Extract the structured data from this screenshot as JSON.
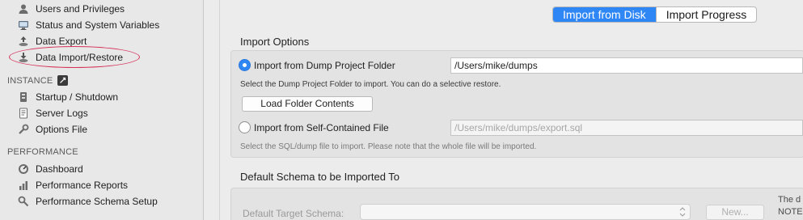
{
  "sidebar": {
    "management_items": [
      {
        "label": "Users and Privileges",
        "icon": "users-icon"
      },
      {
        "label": "Status and System Variables",
        "icon": "monitor-icon"
      },
      {
        "label": "Data Export",
        "icon": "export-icon"
      },
      {
        "label": "Data Import/Restore",
        "icon": "import-icon"
      }
    ],
    "instance_header": "INSTANCE",
    "instance_items": [
      {
        "label": "Startup / Shutdown",
        "icon": "power-icon"
      },
      {
        "label": "Server Logs",
        "icon": "log-icon"
      },
      {
        "label": "Options File",
        "icon": "wrench-icon"
      }
    ],
    "performance_header": "PERFORMANCE",
    "performance_items": [
      {
        "label": "Dashboard",
        "icon": "dashboard-icon"
      },
      {
        "label": "Performance Reports",
        "icon": "reports-icon"
      },
      {
        "label": "Performance Schema Setup",
        "icon": "schema-setup-icon"
      }
    ]
  },
  "tabs": [
    {
      "label": "Import from Disk",
      "active": true
    },
    {
      "label": "Import Progress",
      "active": false
    }
  ],
  "import_options": {
    "title": "Import Options",
    "dump_folder_option": {
      "label": "Import from Dump Project Folder",
      "selected": true,
      "path": "/Users/mike/dumps"
    },
    "dump_folder_hint": "Select the Dump Project Folder to import. You can do a selective restore.",
    "load_folder_button": "Load Folder Contents",
    "self_contained_option": {
      "label": "Import from Self-Contained File",
      "selected": false,
      "path": "/Users/mike/dumps/export.sql"
    },
    "self_contained_hint": "Select the SQL/dump file to import. Please note that the whole file will be imported."
  },
  "default_schema": {
    "title": "Default Schema to be Imported To",
    "target_label": "Default Target Schema:",
    "target_value": "",
    "new_button": "New...",
    "side_note_line1": "The d",
    "side_note_line2": "NOTE"
  },
  "colors": {
    "accent": "#2f86f5",
    "highlight": "#d6325a"
  }
}
